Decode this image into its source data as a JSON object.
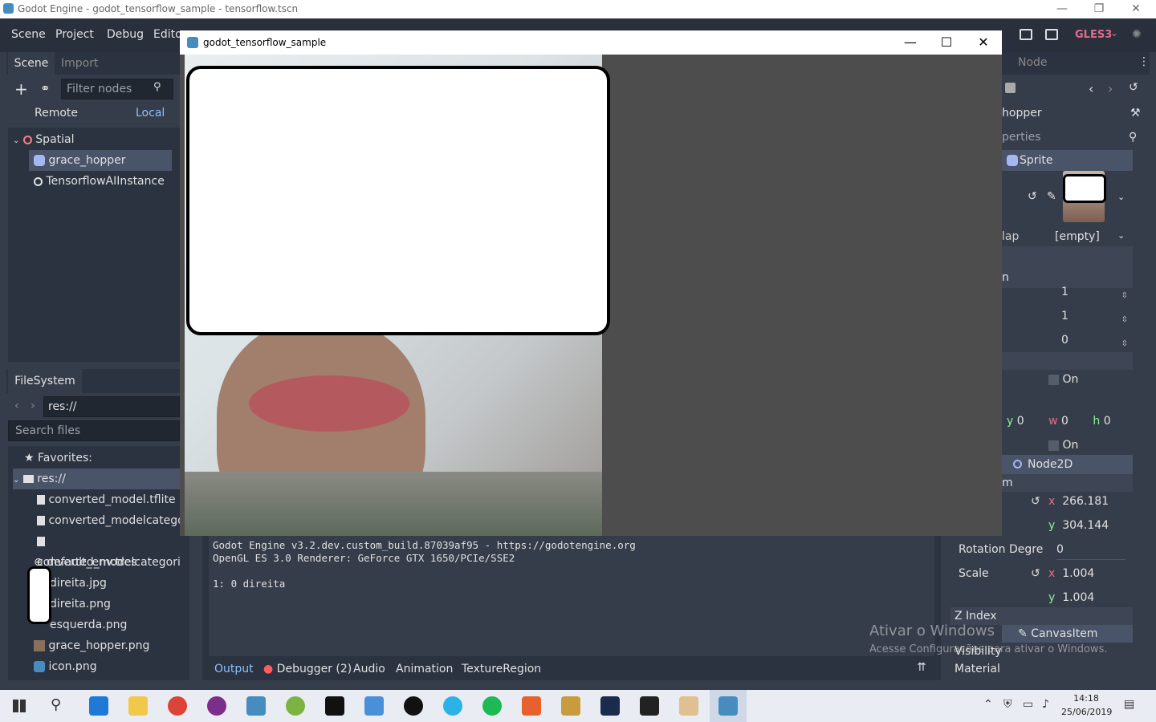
{
  "window_title": "Godot Engine - godot_tensorflow_sample - tensorflow.tscn",
  "window_controls": {
    "minimize": "—",
    "restore": "❐",
    "close": "✕"
  },
  "menu": [
    "Scene",
    "Project",
    "Debug",
    "Edito"
  ],
  "renderer": "GLES3",
  "scene_dock": {
    "tabs": [
      "Scene",
      "Import"
    ],
    "filter_placeholder": "Filter nodes",
    "remote_label": "Remote",
    "local_label": "Local",
    "nodes": [
      {
        "name": "Spatial",
        "level": 0
      },
      {
        "name": "grace_hopper",
        "level": 1,
        "selected": true
      },
      {
        "name": "TensorflowAIInstance",
        "level": 1
      }
    ]
  },
  "filesystem_dock": {
    "tab": "FileSystem",
    "path": "res://",
    "search_placeholder": "Search files",
    "favorites_label": "Favorites:",
    "root_label": "res://",
    "files": [
      "converted_model.tflite",
      "converted_modelcategor",
      "converted_modelcategori",
      "default_env.tres",
      "direita.jpg",
      "direita.png",
      "esquerda.png",
      "grace_hopper.png",
      "icon.png"
    ]
  },
  "output_panel": {
    "lines": [
      "Godot Engine v3.2.dev.custom_build.87039af95 - https://godotengine.org",
      "OpenGL ES 3.0 Renderer: GeForce GTX 1650/PCIe/SSE2",
      "",
      "1: 0 direita"
    ],
    "tabs": [
      "Output",
      "Debugger (2)",
      "Audio",
      "Animation",
      "TextureRegion"
    ]
  },
  "inspector": {
    "tab": "Node",
    "node_name": "hopper",
    "filter_text": "perties",
    "class_sprite": "Sprite",
    "normal_map_label": "lap",
    "normal_map_value": "[empty]",
    "section_n": "n",
    "spin_values": [
      "1",
      "1",
      "0"
    ],
    "on_label_1": "On",
    "rect": {
      "y_label": "y",
      "y": "0",
      "w_label": "w",
      "w": "0",
      "h_label": "h",
      "h": "0"
    },
    "on_label_2": "On",
    "class_node2d": "Node2D",
    "section_m": "m",
    "position": {
      "x_label": "x",
      "x": "266.181",
      "y_label": "y",
      "y": "304.144"
    },
    "rotation_label": "Rotation Degre",
    "rotation_value": "0",
    "scale_label": "Scale",
    "scale": {
      "x_label": "x",
      "x": "1.004",
      "y_label": "y",
      "y": "1.004"
    },
    "z_index_label": "Z Index",
    "class_canvasitem": "CanvasItem",
    "visibility_label": "Visibility",
    "material_label": "Material"
  },
  "activation_watermark": {
    "title": "Ativar o Windows",
    "subtitle": "Acesse Configurações para ativar o Windows."
  },
  "game_window": {
    "title": "godot_tensorflow_sample",
    "controls": {
      "minimize": "—",
      "maximize": "☐",
      "close": "✕"
    }
  },
  "clock": {
    "time": "14:18",
    "date": "25/06/2019"
  }
}
